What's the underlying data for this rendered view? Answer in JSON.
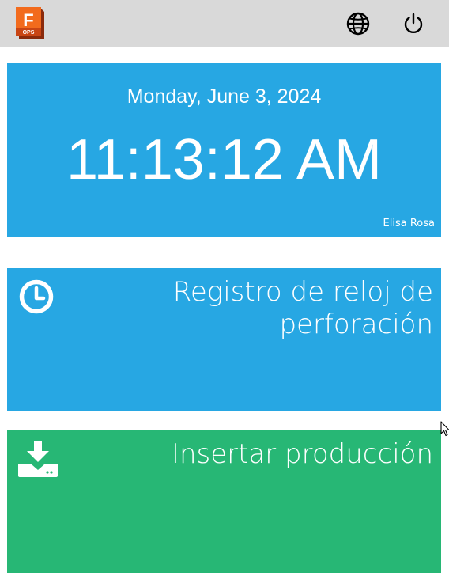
{
  "header": {
    "logo": {
      "letter": "F",
      "badge": "OPS",
      "icon": "app-logo-icon"
    },
    "language_icon": "globe-icon",
    "logout_icon": "power-icon"
  },
  "clock": {
    "date": "Monday, June 3, 2024",
    "time": "11:13:12 AM",
    "user": "Elisa Rosa"
  },
  "tiles": [
    {
      "label": "Registro de reloj de perforación",
      "icon": "clock-icon",
      "color": "#27a7e3"
    },
    {
      "label": "Insertar producción",
      "icon": "download-icon",
      "color": "#27b775"
    }
  ],
  "colors": {
    "header_bg": "#d9d9d9",
    "accent_blue": "#27a7e3",
    "accent_green": "#27b775",
    "logo_orange": "#f26b1d"
  }
}
